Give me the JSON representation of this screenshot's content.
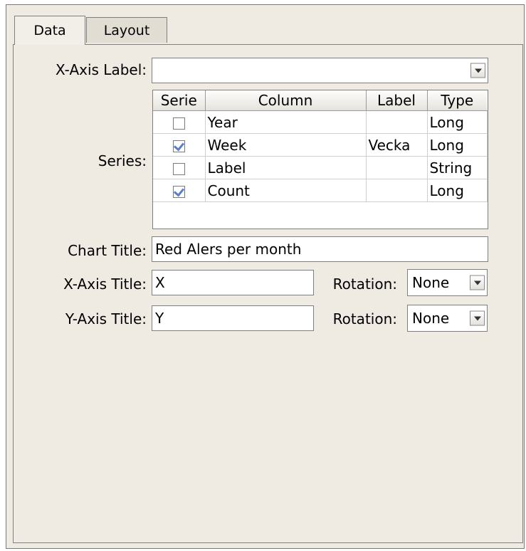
{
  "tabs": [
    {
      "label": "Data"
    },
    {
      "label": "Layout"
    }
  ],
  "xaxis_label": {
    "label": "X-Axis Label:",
    "value": ""
  },
  "series": {
    "label": "Series:",
    "headers": [
      "Serie",
      "Column",
      "Label",
      "Type"
    ],
    "rows": [
      {
        "checked": false,
        "column": "Year",
        "label": "",
        "type": "Long"
      },
      {
        "checked": true,
        "column": "Week",
        "label": "Vecka",
        "type": "Long"
      },
      {
        "checked": false,
        "column": "Label",
        "label": "",
        "type": "String"
      },
      {
        "checked": true,
        "column": "Count",
        "label": "",
        "type": "Long"
      }
    ]
  },
  "chart_title": {
    "label": "Chart Title:",
    "value": "Red Alers per month"
  },
  "xaxis_title": {
    "label": "X-Axis Title:",
    "value": "X",
    "rotation_label": "Rotation:",
    "rotation": "None"
  },
  "yaxis_title": {
    "label": "Y-Axis Title:",
    "value": "Y",
    "rotation_label": "Rotation:",
    "rotation": "None"
  }
}
